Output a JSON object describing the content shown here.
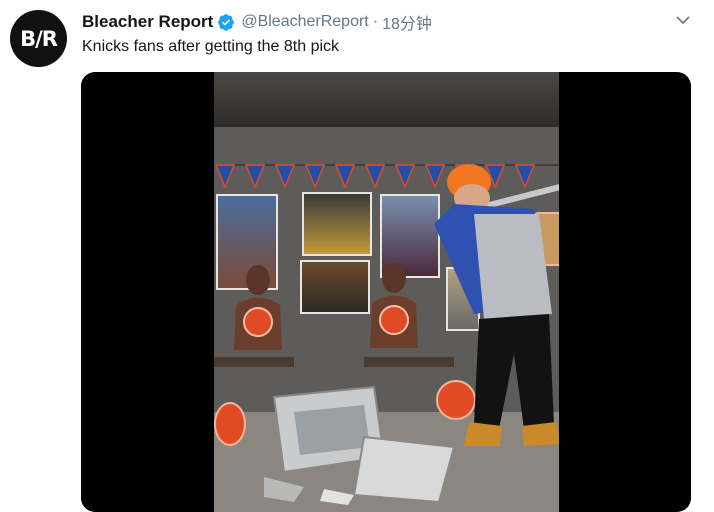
{
  "tweet": {
    "author_name": "Bleacher Report",
    "handle": "@BleacherReport",
    "separator": "·",
    "timestamp": "18分钟",
    "text": "Knicks fans after getting the 8th pick",
    "avatar_text": "B/R"
  },
  "colors": {
    "verified_blue": "#1da1f2",
    "text_primary": "#14171a",
    "text_secondary": "#657786",
    "media_bg": "#000000"
  },
  "icons": {
    "verified": "verified-badge-icon",
    "caret": "chevron-down-icon"
  },
  "media": {
    "type": "video",
    "description_alt": ""
  }
}
